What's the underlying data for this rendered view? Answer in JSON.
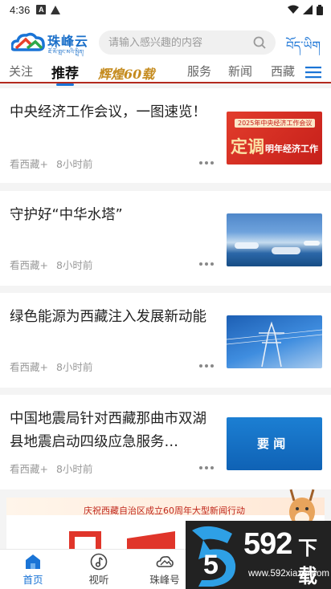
{
  "status_bar": {
    "time": "4:36",
    "notif_a": "A"
  },
  "header": {
    "logo_title": "珠峰云",
    "logo_subtitle": "ཇོ་མོ་གླང་མའི་སྤྲིན།",
    "search_placeholder": "请输入感兴趣的内容",
    "tibetan_label": "བོད་ཡིག"
  },
  "tabs": [
    {
      "label": "关注",
      "active": false
    },
    {
      "label": "推荐",
      "active": true
    },
    {
      "label": "辉煌60载",
      "active": false
    },
    {
      "label": "服务",
      "active": false
    },
    {
      "label": "新闻",
      "active": false
    },
    {
      "label": "西藏",
      "active": false
    }
  ],
  "feed": [
    {
      "title": "中央经济工作会议，一图速览！",
      "source": "看西藏+",
      "time": "8小时前",
      "thumb_text_top": "2025年中央经济工作会议",
      "thumb_text_main": "定调",
      "thumb_text_sub": "明年经济工作"
    },
    {
      "title": "守护好“中华水塔”",
      "source": "看西藏+",
      "time": "8小时前"
    },
    {
      "title": "绿色能源为西藏注入发展新动能",
      "source": "看西藏+",
      "time": "8小时前"
    },
    {
      "title": "中国地震局针对西藏那曲市双湖县地震启动四级应急服务…",
      "source": "看西藏+",
      "time": "8小时前",
      "thumb_text_main": "要 闻"
    }
  ],
  "banner": {
    "text": "庆祝西藏自治区成立60周年大型新闻行动"
  },
  "bottom_nav": [
    {
      "label": "首页",
      "icon": "home-icon",
      "active": true
    },
    {
      "label": "视听",
      "icon": "music-icon",
      "active": false
    },
    {
      "label": "珠峰号",
      "icon": "cloud-icon",
      "active": false
    }
  ],
  "watermark": {
    "number": "592",
    "suffix": "下载",
    "url": "www.592xiazai.com"
  },
  "colors": {
    "brand_blue": "#1a74d6",
    "tab_underline_red": "#b32a1e",
    "text_gray": "#999999"
  }
}
